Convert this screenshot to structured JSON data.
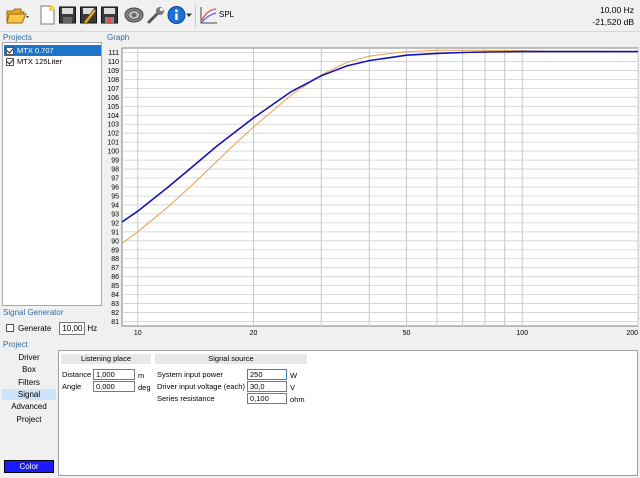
{
  "toolbar": {
    "icons": [
      "open-folder-icon",
      "new-document-icon",
      "save-icon",
      "edit-save-icon",
      "save-as-icon",
      "speaker-icon",
      "wrench-icon",
      "info-icon",
      "graph-icon"
    ],
    "graph_label": "SPL",
    "readout_freq": "10,00 Hz",
    "readout_db": "-21,520 dB"
  },
  "projects": {
    "title": "Projects",
    "items": [
      {
        "label": "MTX 0.707",
        "checked": true,
        "selected": true
      },
      {
        "label": "MTX  125Liter",
        "checked": true,
        "selected": false
      }
    ]
  },
  "graph": {
    "title": "Graph"
  },
  "chart_data": {
    "type": "line",
    "title": "",
    "xlabel": "",
    "ylabel": "",
    "x_scale": "log",
    "xlim": [
      9.1,
      200
    ],
    "ylim": [
      80.5,
      111.5
    ],
    "x_ticks": [
      10,
      20,
      50,
      100,
      200
    ],
    "x_tick_labels": [
      "10",
      "20",
      "50",
      "100",
      "200"
    ],
    "y_ticks": [
      81,
      82,
      83,
      84,
      85,
      86,
      87,
      88,
      89,
      90,
      91,
      92,
      93,
      94,
      95,
      96,
      97,
      98,
      99,
      100,
      101,
      102,
      103,
      104,
      105,
      106,
      107,
      108,
      109,
      110,
      111
    ],
    "y_tick_labels": [
      "81",
      "82",
      "83",
      "84",
      "85",
      "86",
      "87",
      "88",
      "89",
      "90",
      "91",
      "92",
      "93",
      "94",
      "95",
      "96",
      "97",
      "98",
      "99",
      "100",
      "101",
      "102",
      "103",
      "104",
      "105",
      "106",
      "107",
      "108",
      "109",
      "110",
      "111"
    ],
    "grid": true,
    "series": [
      {
        "color": "#1414b4",
        "x": [
          9.1,
          10,
          12,
          14,
          16,
          18,
          20,
          25,
          30,
          35,
          40,
          50,
          60,
          70,
          80,
          100,
          120,
          150,
          200
        ],
        "y": [
          92.1,
          93.3,
          96.0,
          98.4,
          100.5,
          102.2,
          103.7,
          106.6,
          108.4,
          109.5,
          110.1,
          110.7,
          110.9,
          111.0,
          111.05,
          111.1,
          111.1,
          111.1,
          111.1
        ]
      },
      {
        "color": "#e8a050",
        "x": [
          9.1,
          10,
          12,
          14,
          16,
          18,
          20,
          25,
          30,
          35,
          40,
          50,
          60,
          70,
          80,
          100,
          120,
          150,
          200
        ],
        "y": [
          89.7,
          91.0,
          93.8,
          96.4,
          98.8,
          100.9,
          102.7,
          106.2,
          108.5,
          109.9,
          110.6,
          111.1,
          111.25,
          111.25,
          111.25,
          111.2,
          111.15,
          111.15,
          111.1
        ]
      }
    ]
  },
  "signal_generator": {
    "title": "Signal Generator",
    "generate_label": "Generate",
    "generate_checked": false,
    "frequency_value": "10,00",
    "frequency_unit": "Hz"
  },
  "project": {
    "title": "Project",
    "nav": [
      "Driver",
      "Box",
      "Filters",
      "Signal",
      "Advanced",
      "Project"
    ],
    "active_nav": "Signal",
    "color_button": "Color",
    "color_swatch": "#1a1aff"
  },
  "listening_place": {
    "header": "Listening place",
    "distance_label": "Distance",
    "distance_value": "1,000",
    "distance_unit": "m",
    "angle_label": "Angle",
    "angle_value": "0,000",
    "angle_unit": "deg"
  },
  "signal_source": {
    "header": "Signal source",
    "power_label": "System input power",
    "power_value": "250",
    "power_unit": "W",
    "voltage_label": "Driver input voltage (each)",
    "voltage_value": "30,0",
    "voltage_unit": "V",
    "resistance_label": "Series resistance",
    "resistance_value": "0,100",
    "resistance_unit": "ohm"
  }
}
